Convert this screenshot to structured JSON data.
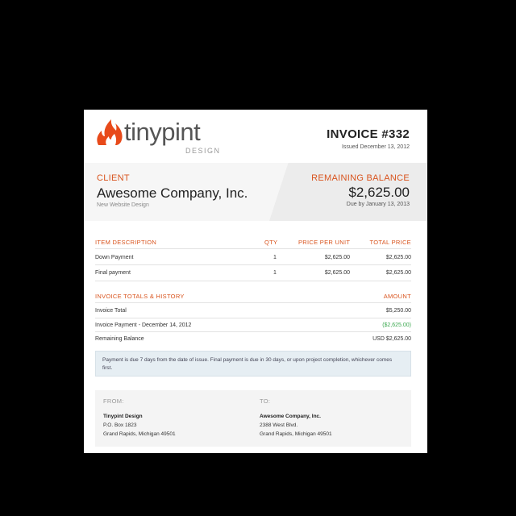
{
  "logo": {
    "word": "tinypint",
    "sub": "DESIGN"
  },
  "invoice": {
    "title": "INVOICE #332",
    "issued": "Issued December 13, 2012"
  },
  "client": {
    "label": "CLIENT",
    "name": "Awesome Company, Inc.",
    "project": "New Website Design"
  },
  "balance": {
    "label": "REMAINING BALANCE",
    "amount": "$2,625.00",
    "due": "Due by January 13, 2013"
  },
  "items": {
    "headers": {
      "desc": "ITEM DESCRIPTION",
      "qty": "QTY",
      "ppu": "PRICE PER UNIT",
      "total": "TOTAL PRICE"
    },
    "rows": [
      {
        "desc": "Down Payment",
        "qty": "1",
        "ppu": "$2,625.00",
        "total": "$2,625.00"
      },
      {
        "desc": "Final payment",
        "qty": "1",
        "ppu": "$2,625.00",
        "total": "$2,625.00"
      }
    ]
  },
  "totals": {
    "header": "INVOICE TOTALS & HISTORY",
    "amount_header": "AMOUNT",
    "rows": [
      {
        "label": "Invoice Total",
        "amount": "$5,250.00"
      },
      {
        "label": "Invoice Payment - December 14, 2012",
        "amount": "($2,625.00)"
      },
      {
        "label": "Remaining Balance",
        "amount": "USD $2,625.00"
      }
    ]
  },
  "note": "Payment is due 7 days from the date of issue. Final payment is due in 30 days, or upon project completion, whichever comes first.",
  "from": {
    "label": "FROM:",
    "name": "Tinypint Design",
    "line1": "P.O. Box 1823",
    "line2": "Grand Rapids, Michigan 49501"
  },
  "to": {
    "label": "TO:",
    "name": "Awesome Company, Inc.",
    "line1": "2388 West Blvd.",
    "line2": "Grand Rapids, Michigan 49501"
  },
  "colors": {
    "accent": "#d9541e",
    "credit": "#3ba84f",
    "note_bg": "#e6eef3"
  }
}
